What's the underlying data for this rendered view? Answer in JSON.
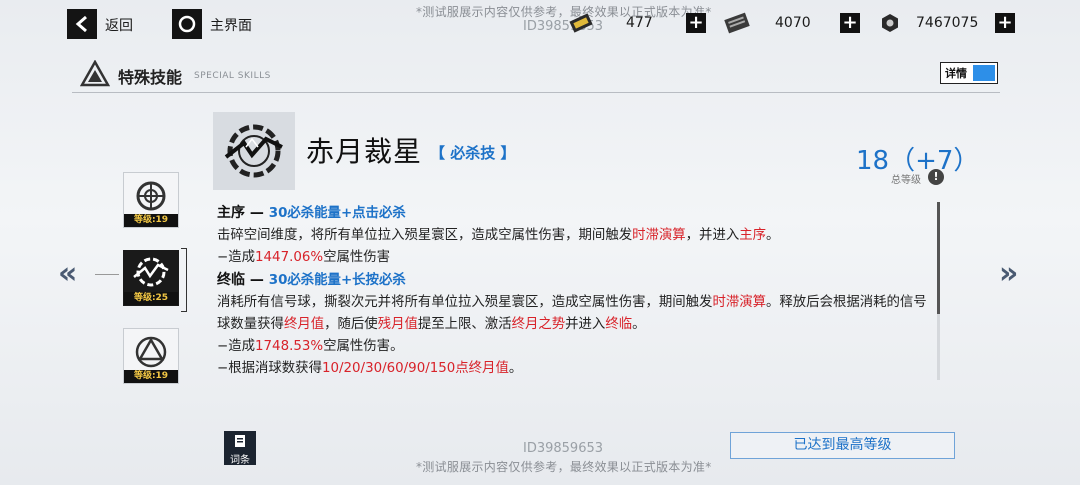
{
  "nav": {
    "back_label": "返回",
    "home_label": "主界面"
  },
  "notice": "*测试服展示内容仅供参考，最终效果以正式版本为准*",
  "user_id": "ID39859653",
  "resources": [
    {
      "icon": "ticket-icon",
      "value": "477"
    },
    {
      "icon": "card-icon",
      "value": "4070"
    },
    {
      "icon": "nut-icon",
      "value": "7467075"
    }
  ],
  "section": {
    "title": "特殊技能",
    "subtitle": "SPECIAL SKILLS",
    "detail_label": "详情"
  },
  "skill": {
    "name": "赤月裁星",
    "tag": "【 必杀技 】",
    "level": "18（+7）",
    "level_label": "总等级",
    "info": "!",
    "main_title": "主序 — ",
    "main_cost": "30必杀能量+点击必杀",
    "main_desc_1": "击碎空间维度，将所有单位拉入殒星寰区，造成空属性伤害，期间触发",
    "main_kw_1": "时滞演算",
    "main_desc_2": "，并进入",
    "main_kw_2": "主序",
    "main_desc_3": "。",
    "main_dmg_pre": "−造成",
    "main_dmg_val": "1447.06%",
    "main_dmg_post": "空属性伤害",
    "final_title": "终临 — ",
    "final_cost": "30必杀能量+长按必杀",
    "final_desc_1": "消耗所有信号球，撕裂次元并将所有单位拉入殒星寰区，造成空属性伤害，期间触发",
    "final_kw_1": "时滞演算",
    "final_desc_2": "。释放后会根据消耗的信号球数量获得",
    "final_kw_2": "终月值",
    "final_desc_3": "，随后使",
    "final_kw_3": "残月值",
    "final_desc_4": "提至上限、激活",
    "final_kw_4": "终月之势",
    "final_desc_5": "并进入",
    "final_kw_5": "终临",
    "final_desc_6": "。",
    "final_dmg_pre": "−造成",
    "final_dmg_val": "1748.53%",
    "final_dmg_post": "空属性伤害。",
    "final_gain_pre": "−根据消球数获得",
    "final_gain_val": "10/20/30/60/90/150点终月值",
    "final_gain_post": "。"
  },
  "skill_list": [
    {
      "level": "等级:19",
      "icon": "target-skill-icon"
    },
    {
      "level": "等级:25",
      "icon": "moon-skill-icon"
    },
    {
      "level": "等级:19",
      "icon": "triangle-skill-icon"
    }
  ],
  "bottom": {
    "doc_label": "词条",
    "max_label": "已达到最高等级"
  },
  "colors": {
    "accent_blue": "#1d72c8",
    "highlight_red": "#d8232a",
    "level_gold": "#f2c744"
  }
}
